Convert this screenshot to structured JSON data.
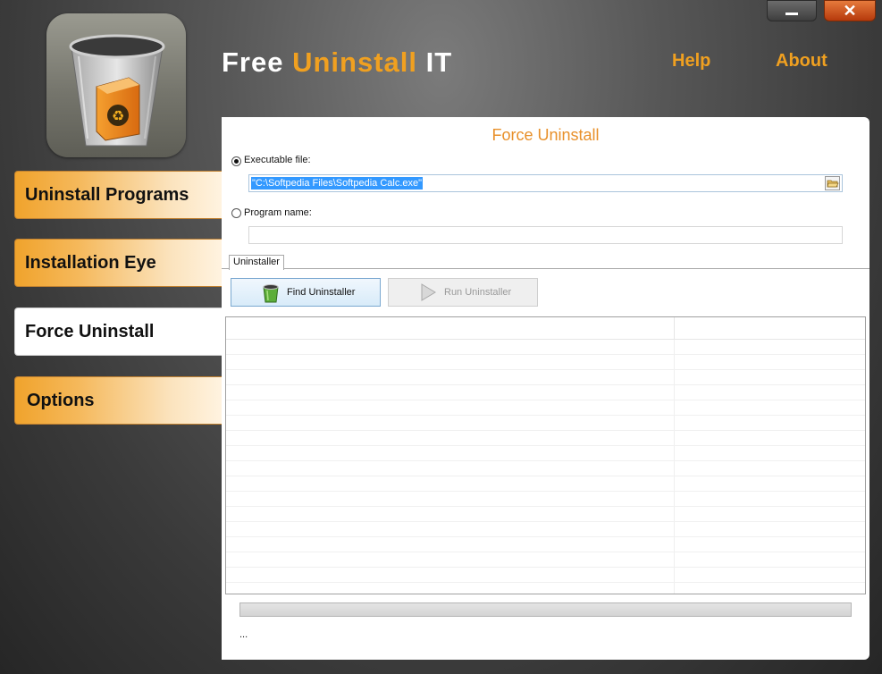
{
  "app": {
    "title_part1": "Free",
    "title_part2": "Uninstall",
    "title_part3": "IT",
    "close_glyph": "✕"
  },
  "header_links": {
    "help": "Help",
    "about": "About"
  },
  "sidebar": {
    "items": [
      {
        "label": "Uninstall Programs",
        "active": false
      },
      {
        "label": "Installation Eye",
        "active": false
      },
      {
        "label": "Force Uninstall",
        "active": true
      },
      {
        "label": "Options",
        "active": false
      }
    ]
  },
  "panel": {
    "title": "Force Uninstall",
    "executable_label": "Executable file:",
    "executable_value": "\"C:\\Softpedia Files\\Softpedia Calc.exe\"",
    "program_name_label": "Program name:",
    "program_name_value": "",
    "tab_label": "Uninstaller",
    "find_button": "Find Uninstaller",
    "run_button": "Run Uninstaller",
    "status_text": "...",
    "progress": 0
  },
  "colors": {
    "accent": "#f0a020",
    "panel_title": "#e8902a",
    "selection": "#3399ff"
  },
  "icons": [
    "recycle-bin-logo-icon",
    "minimize-icon",
    "close-icon",
    "folder-browse-icon",
    "green-bin-icon",
    "play-icon"
  ]
}
